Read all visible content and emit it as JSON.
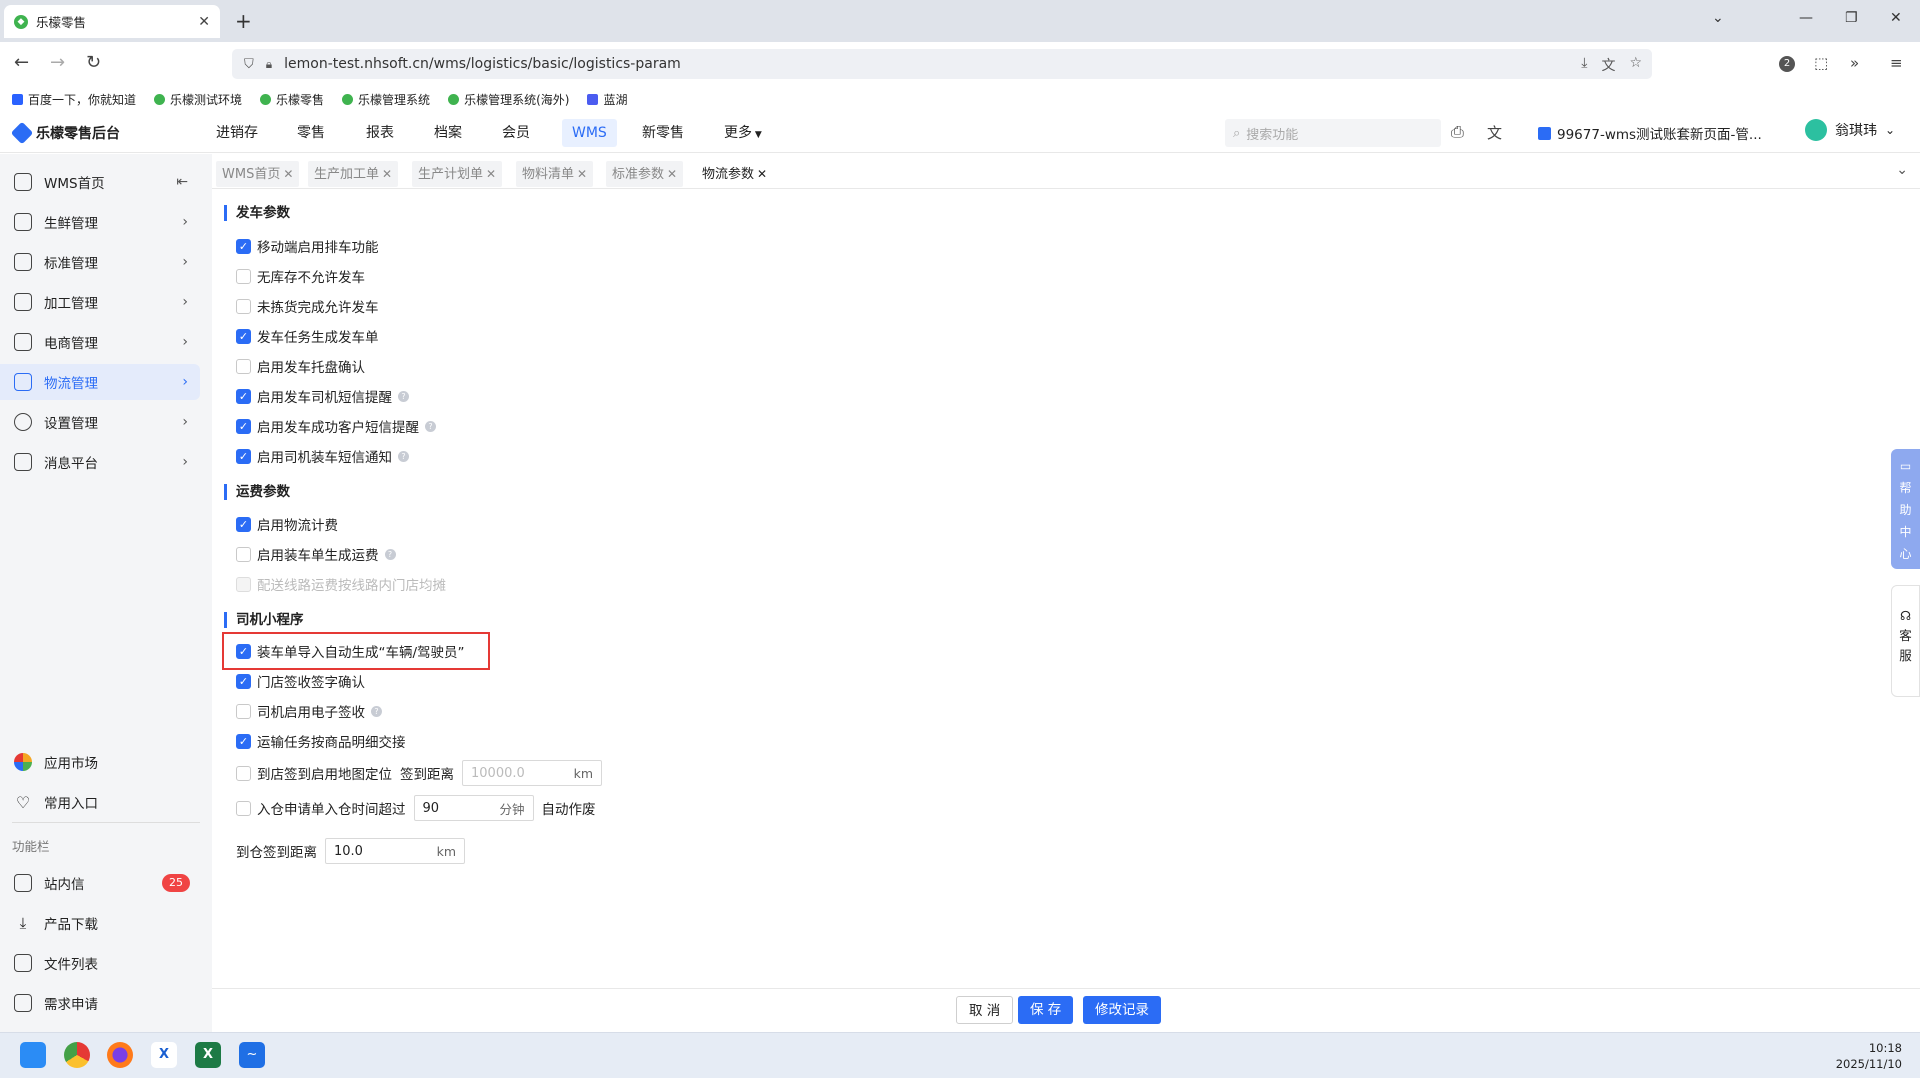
{
  "browser": {
    "tab_title": "乐檬零售",
    "url": "lemon-test.nhsoft.cn/wms/logistics/basic/logistics-param",
    "extensions_badge": "2",
    "bookmarks": [
      {
        "label": "百度一下，你就知道",
        "icon": "baidu-icon"
      },
      {
        "label": "乐檬测试环境",
        "icon": "lemon-icon"
      },
      {
        "label": "乐檬零售",
        "icon": "lemon-icon"
      },
      {
        "label": "乐檬管理系统",
        "icon": "lemon-icon"
      },
      {
        "label": "乐檬管理系统(海外)",
        "icon": "lemon-icon"
      },
      {
        "label": "蓝湖",
        "icon": "lanhu-icon"
      }
    ]
  },
  "app": {
    "logo_text": "乐檬零售后台",
    "menu": [
      "进销存",
      "零售",
      "报表",
      "档案",
      "会员",
      "WMS",
      "新零售",
      "更多"
    ],
    "active_menu": "WMS",
    "search_placeholder": "搜索功能",
    "account": "99677-wms测试账套新页面-管...",
    "user_name": "翁琪玮"
  },
  "sidebar": {
    "items": [
      {
        "label": "WMS首页",
        "icon": "home-icon"
      },
      {
        "label": "生鲜管理",
        "icon": "fresh-icon"
      },
      {
        "label": "标准管理",
        "icon": "standard-icon"
      },
      {
        "label": "加工管理",
        "icon": "process-icon"
      },
      {
        "label": "电商管理",
        "icon": "shop-icon"
      },
      {
        "label": "物流管理",
        "icon": "logistics-icon"
      },
      {
        "label": "设置管理",
        "icon": "settings-icon"
      },
      {
        "label": "消息平台",
        "icon": "message-icon"
      }
    ],
    "bottom": [
      {
        "label": "应用市场",
        "icon": "app-market-icon"
      },
      {
        "label": "常用入口",
        "icon": "heart-icon"
      }
    ],
    "section_label": "功能栏",
    "tools": [
      {
        "label": "站内信",
        "icon": "mail-icon",
        "badge": "25"
      },
      {
        "label": "产品下载",
        "icon": "download-icon"
      },
      {
        "label": "文件列表",
        "icon": "file-list-icon"
      },
      {
        "label": "需求申请",
        "icon": "request-icon"
      }
    ]
  },
  "page_tabs": [
    "WMS首页",
    "生产加工单",
    "生产计划单",
    "物料清单",
    "标准参数",
    "物流参数"
  ],
  "form": {
    "departure": {
      "title": "发车参数",
      "options": [
        {
          "label": "移动端启用排车功能",
          "checked": true
        },
        {
          "label": "无库存不允许发车",
          "checked": false
        },
        {
          "label": "未拣货完成允许发车",
          "checked": false
        },
        {
          "label": "发车任务生成发车单",
          "checked": true
        },
        {
          "label": "启用发车托盘确认",
          "checked": false
        },
        {
          "label": "启用发车司机短信提醒",
          "checked": true,
          "help": true
        },
        {
          "label": "启用发车成功客户短信提醒",
          "checked": true,
          "help": true
        },
        {
          "label": "启用司机装车短信通知",
          "checked": true,
          "help": true
        }
      ]
    },
    "freight": {
      "title": "运费参数",
      "options": [
        {
          "label": "启用物流计费",
          "checked": true
        },
        {
          "label": "启用装车单生成运费",
          "checked": false,
          "help": true
        },
        {
          "label": "配送线路运费按线路内门店均摊",
          "checked": false,
          "disabled": true
        }
      ]
    },
    "driver": {
      "title": "司机小程序",
      "options": [
        {
          "label": "装车单导入自动生成“车辆/驾驶员”",
          "checked": true
        },
        {
          "label": "门店签收签字确认",
          "checked": true
        },
        {
          "label": "司机启用电子签收",
          "checked": false,
          "help": true
        },
        {
          "label": "运输任务按商品明细交接",
          "checked": true
        }
      ],
      "store_checkin": {
        "label": "到店签到启用地图定位",
        "checked": false,
        "distance_label": "签到距离",
        "placeholder": "10000.0",
        "unit": "km"
      },
      "inbound_expire": {
        "label": "入仓申请单入仓时间超过",
        "checked": false,
        "value": "90",
        "unit": "分钟",
        "suffix": "自动作废"
      },
      "warehouse_checkin": {
        "label": "到仓签到距离",
        "value": "10.0",
        "unit": "km"
      }
    }
  },
  "footer": {
    "cancel": "取 消",
    "save": "保 存",
    "history": "修改记录"
  },
  "floats": {
    "help": [
      "帮",
      "助",
      "中",
      "心"
    ],
    "service": [
      "客",
      "服"
    ]
  },
  "taskbar": {
    "time": "10:18",
    "date": "2025/11/10"
  }
}
